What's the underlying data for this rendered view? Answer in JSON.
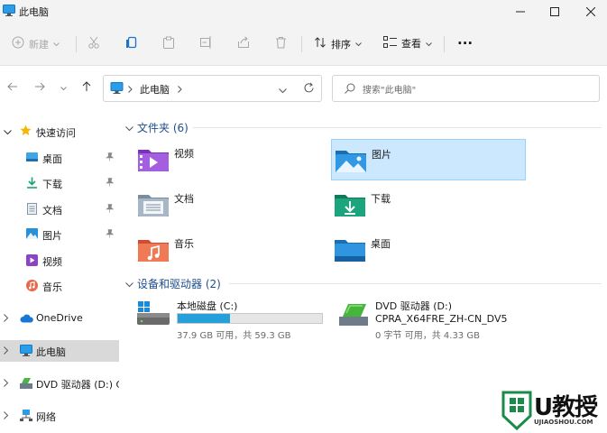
{
  "window": {
    "title": "此电脑"
  },
  "toolbar": {
    "new_label": "新建",
    "sort_label": "排序",
    "view_label": "查看",
    "more_label": "..."
  },
  "address": {
    "segment": "此电脑",
    "search_placeholder": "搜索\"此电脑\""
  },
  "sidebar": {
    "quick_access": "快速访问",
    "items": [
      {
        "label": "桌面",
        "icon": "desktop-icon"
      },
      {
        "label": "下载",
        "icon": "download-icon"
      },
      {
        "label": "文档",
        "icon": "document-icon"
      },
      {
        "label": "图片",
        "icon": "picture-icon"
      },
      {
        "label": "视频",
        "icon": "video-icon"
      },
      {
        "label": "音乐",
        "icon": "music-icon"
      }
    ],
    "onedrive": "OneDrive",
    "this_pc": "此电脑",
    "dvd": "DVD 驱动器 (D:) CI",
    "network": "网络"
  },
  "folders_group": {
    "title": "文件夹 (6)"
  },
  "folders": [
    {
      "name": "视频",
      "icon": "video-folder-icon"
    },
    {
      "name": "图片",
      "icon": "picture-folder-icon"
    },
    {
      "name": "文档",
      "icon": "document-folder-icon"
    },
    {
      "name": "下载",
      "icon": "download-folder-icon"
    },
    {
      "name": "音乐",
      "icon": "music-folder-icon"
    },
    {
      "name": "桌面",
      "icon": "desktop-folder-icon"
    }
  ],
  "drives_group": {
    "title": "设备和驱动器 (2)"
  },
  "drives": [
    {
      "name": "本地磁盘 (C:)",
      "info": "37.9 GB 可用，共 59.3 GB",
      "used_fraction": 0.36
    },
    {
      "name": "DVD 驱动器 (D:)",
      "label": "CPRA_X64FRE_ZH-CN_DV5",
      "info": "0 字节 可用，共 4.33 GB"
    }
  ],
  "watermark": {
    "brand": "U教授",
    "url": "UJIAOSHOU.COM"
  },
  "colors": {
    "accent": "#0067c0",
    "selection": "#cce8ff",
    "drive_bar": "#26a0da",
    "group_title": "#1f4e8c"
  }
}
